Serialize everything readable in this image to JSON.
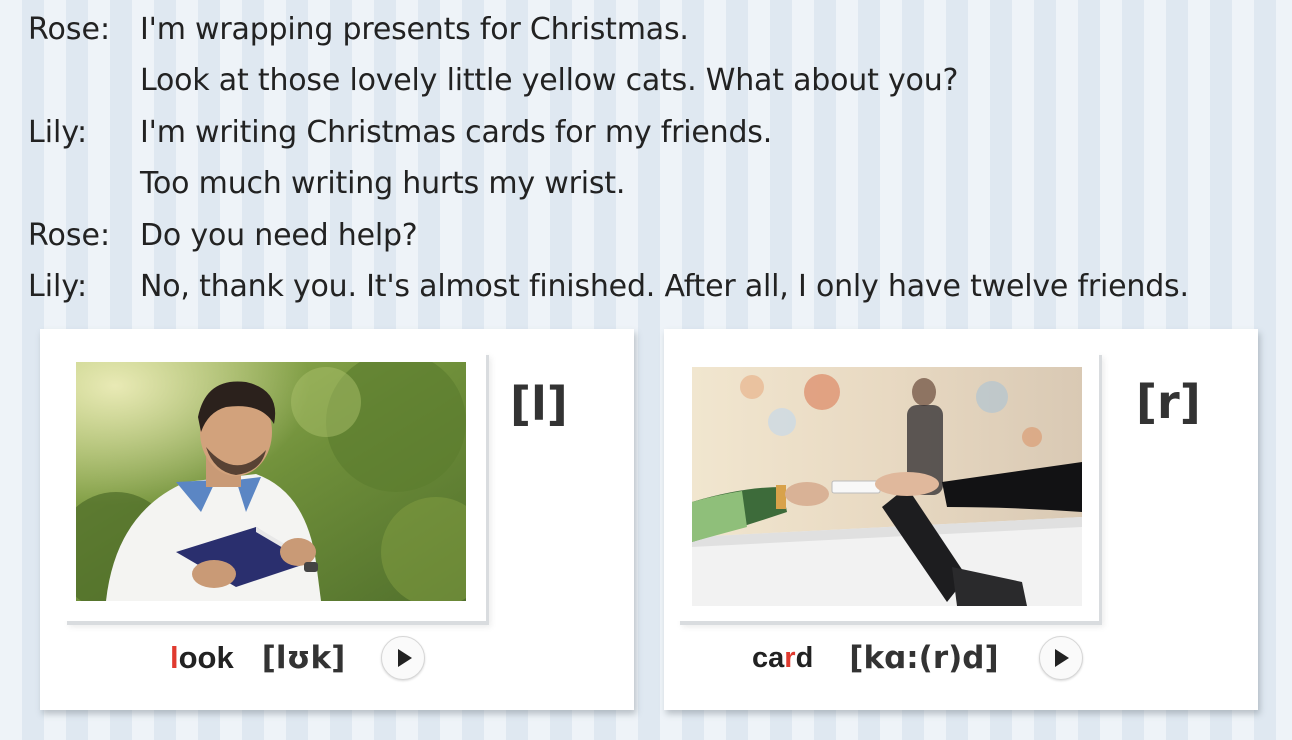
{
  "dialogue": [
    {
      "speaker": "Rose:",
      "text": "I'm wrapping presents for Christmas."
    },
    {
      "speaker": "",
      "text": "Look at those lovely little yellow cats. What about you?"
    },
    {
      "speaker": "Lily:",
      "text": "I'm writing Christmas cards for my friends."
    },
    {
      "speaker": "",
      "text": "Too much writing hurts my wrist."
    },
    {
      "speaker": "Rose:",
      "text": "Do you need help?"
    },
    {
      "speaker": "Lily:",
      "text": "No, thank you. It's almost finished. After all, I only have twelve friends."
    }
  ],
  "cards": [
    {
      "ipa_symbol": "[l]",
      "word_parts": [
        "",
        "l",
        "ook"
      ],
      "phonetic": "[lʊk]",
      "photo_icon": "man-reading-book-photo",
      "play_icon": "play-icon"
    },
    {
      "ipa_symbol": "[r]",
      "word_parts": [
        "ca",
        "r",
        "d"
      ],
      "phonetic": "[kɑ:(r)d]",
      "photo_icon": "card-handover-photo",
      "play_icon": "play-icon"
    }
  ],
  "colors": {
    "highlight": "#e03a2f",
    "stripe_light": "#eef3f8",
    "stripe_dark": "#dfe8f1"
  }
}
